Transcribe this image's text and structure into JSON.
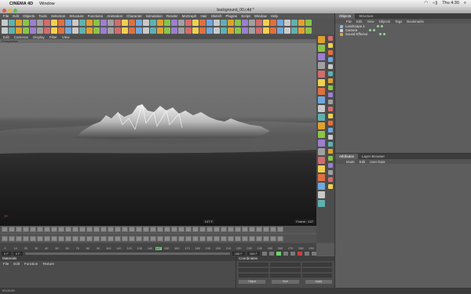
{
  "mac_menubar": {
    "app_name": "CINEMA 4D",
    "items": [
      "Window"
    ],
    "clock": "Thu 4:30"
  },
  "window": {
    "title": "background_00.c4d *"
  },
  "main_menu": [
    "File",
    "Edit",
    "Objects",
    "Tools",
    "Selection",
    "Structure",
    "Functions",
    "Animation",
    "Character",
    "Simulation",
    "Render",
    "MoGraph",
    "Hair",
    "Sketch",
    "Plugins",
    "Script",
    "Window",
    "Help"
  ],
  "viewport": {
    "menu": [
      "Edit",
      "Cameras",
      "Display",
      "Filter",
      "View"
    ],
    "label": "Perspective",
    "frame_readout": "147 F",
    "frames_readout": "Frame : 147"
  },
  "timeline": {
    "ticks": [
      "0",
      "10",
      "20",
      "30",
      "40",
      "50",
      "60",
      "70",
      "80",
      "90",
      "100",
      "110",
      "120",
      "130",
      "140",
      "150",
      "160",
      "170",
      "180",
      "190",
      "200",
      "210",
      "220",
      "230",
      "240",
      "250",
      "260",
      "270",
      "280",
      "290"
    ],
    "current": "147",
    "end_label": "288 F",
    "start_field": "0 F",
    "min_field": "0 F",
    "max_field": "288 F"
  },
  "materials": {
    "title": "Materials",
    "menu": [
      "File",
      "Edit",
      "Function",
      "Texture"
    ]
  },
  "coordinates": {
    "title": "Coordinates",
    "buttons": [
      "Object",
      "Size",
      "Apply"
    ]
  },
  "object_manager": {
    "tabs": [
      "Objects",
      "Structure"
    ],
    "active_tab": 0,
    "menu": [
      "File",
      "Edit",
      "View",
      "Objects",
      "Tags",
      "Bookmarks"
    ],
    "objects": [
      {
        "name": "Landscape.1",
        "icon_color": "#8fb7e0"
      },
      {
        "name": "Camera",
        "icon_color": "#cfcfcf"
      },
      {
        "name": "Sound Effector",
        "icon_color": "#d9a34a"
      }
    ]
  },
  "attribute_manager": {
    "tabs": [
      "Attributes",
      "Layer Browser"
    ],
    "active_tab": 0,
    "menu": [
      "Mode",
      "Edit",
      "User Data"
    ]
  },
  "status_bar": {
    "text": "00:00:00"
  },
  "colors": {
    "accent_green": "#6cd36c",
    "panel_bg": "#5d5d5d",
    "viewport_ground": "#1a1a1a"
  }
}
